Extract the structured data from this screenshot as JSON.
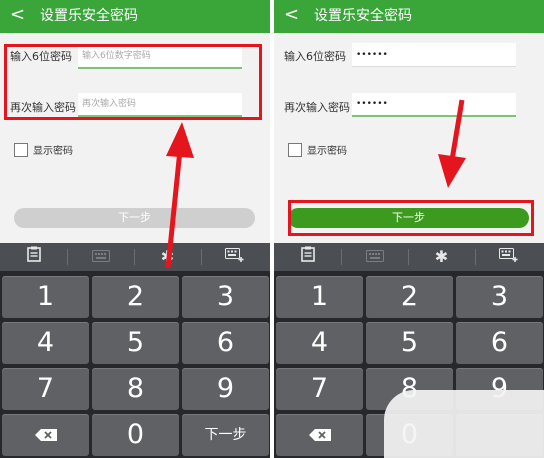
{
  "screens": [
    {
      "back_glyph": "<",
      "title": "设置乐安全密码",
      "field1": {
        "label": "输入6位密码",
        "value": "",
        "placeholder": "输入6位数字密码"
      },
      "field2": {
        "label": "再次输入密码",
        "value": "",
        "placeholder": "再次输入密码"
      },
      "show_password": {
        "label": "显示密码",
        "checked": false
      },
      "next_button": {
        "label": "下一步",
        "enabled": false
      },
      "toolbar_icons": [
        "clipboard-icon",
        "keyboard-icon",
        "gear-icon",
        "keyboard-add-icon"
      ],
      "keys": [
        "1",
        "2",
        "3",
        "4",
        "5",
        "6",
        "7",
        "8",
        "9",
        "⌫",
        "0",
        "下一步"
      ]
    },
    {
      "back_glyph": "<",
      "title": "设置乐安全密码",
      "field1": {
        "label": "输入6位密码",
        "value": "••••••",
        "placeholder": ""
      },
      "field2": {
        "label": "再次输入密码",
        "value": "••••••",
        "placeholder": ""
      },
      "show_password": {
        "label": "显示密码",
        "checked": false
      },
      "next_button": {
        "label": "下一步",
        "enabled": true
      },
      "toolbar_icons": [
        "clipboard-icon",
        "keyboard-icon",
        "gear-icon",
        "keyboard-add-icon"
      ],
      "keys": [
        "1",
        "2",
        "3",
        "4",
        "5",
        "6",
        "7",
        "8",
        "9",
        "⌫",
        "0",
        ""
      ]
    }
  ],
  "colors": {
    "header_green": "#3aa63a",
    "button_active": "#3c9a1e",
    "highlight_red": "#e5151d",
    "keyboard_bg": "#26282b",
    "key_bg": "#5f6165"
  }
}
